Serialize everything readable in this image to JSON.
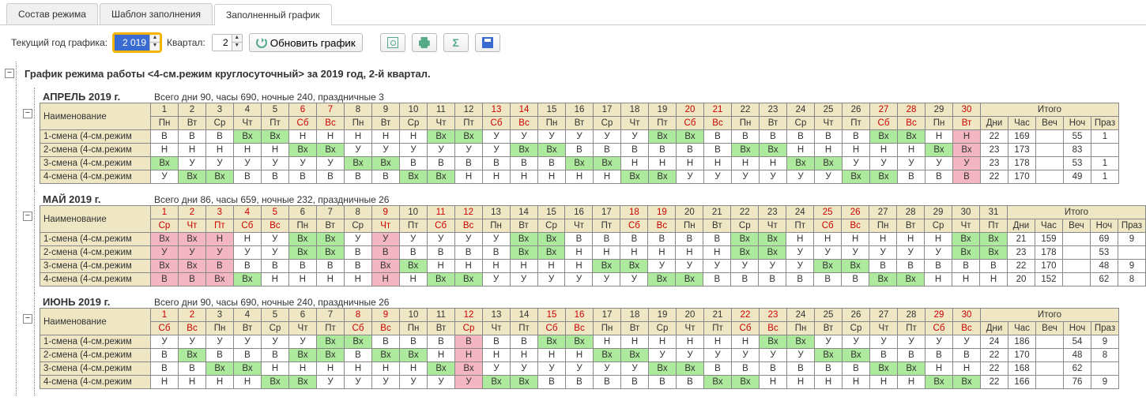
{
  "tabs": [
    "Состав режима",
    "Шаблон заполнения",
    "Заполненный график"
  ],
  "activeTab": 2,
  "toolbar": {
    "yearLabel": "Текущий год графика:",
    "yearValue": "2 019",
    "quarterLabel": "Квартал:",
    "quarterValue": "2",
    "refreshLabel": "Обновить график"
  },
  "title": "График режима работы <4-см.режим круглосуточный> за 2019 год, 2-й квартал.",
  "labels": {
    "name": "Наименование",
    "total": "Итого"
  },
  "sumCols": [
    "Дни",
    "Час",
    "Веч",
    "Ноч",
    "Праз"
  ],
  "dows": [
    "Пн",
    "Вт",
    "Ср",
    "Чт",
    "Пт",
    "Сб",
    "Вс"
  ],
  "rowNames": [
    "1-смена (4-см.режим",
    "2-смена (4-см.режим",
    "3-смена (4-см.режим",
    "4-смена (4-см.режим"
  ],
  "months": [
    {
      "name": "АПРЕЛЬ 2019 г.",
      "summary": "Всего дни 90, часы 690, ночные 240, праздничные 3",
      "days": 30,
      "startDow": 0,
      "holidays": [
        30
      ],
      "rows": [
        {
          "c": [
            "В",
            "В",
            "В",
            "Вх",
            "Вх",
            "Н",
            "Н",
            "Н",
            "Н",
            "Н",
            "Вх",
            "Вх",
            "У",
            "У",
            "У",
            "У",
            "У",
            "У",
            "Вх",
            "Вх",
            "В",
            "В",
            "В",
            "В",
            "В",
            "В",
            "Вх",
            "Вх",
            "Н",
            "Н"
          ],
          "s": [
            "22",
            "169",
            "",
            "55",
            "1"
          ]
        },
        {
          "c": [
            "Н",
            "Н",
            "Н",
            "Н",
            "Н",
            "Вх",
            "Вх",
            "У",
            "У",
            "У",
            "У",
            "У",
            "У",
            "Вх",
            "Вх",
            "В",
            "В",
            "В",
            "В",
            "В",
            "В",
            "Вх",
            "Вх",
            "Н",
            "Н",
            "Н",
            "Н",
            "Н",
            "Вх",
            "Вх"
          ],
          "s": [
            "23",
            "173",
            "",
            "83",
            ""
          ]
        },
        {
          "c": [
            "Вх",
            "У",
            "У",
            "У",
            "У",
            "У",
            "У",
            "Вх",
            "Вх",
            "В",
            "В",
            "В",
            "В",
            "В",
            "В",
            "Вх",
            "Вх",
            "Н",
            "Н",
            "Н",
            "Н",
            "Н",
            "Н",
            "Вх",
            "Вх",
            "У",
            "У",
            "У",
            "У",
            "У"
          ],
          "s": [
            "23",
            "178",
            "",
            "53",
            "1"
          ]
        },
        {
          "c": [
            "У",
            "Вх",
            "Вх",
            "В",
            "В",
            "В",
            "В",
            "В",
            "В",
            "Вх",
            "Вх",
            "Н",
            "Н",
            "Н",
            "Н",
            "Н",
            "Н",
            "Вх",
            "Вх",
            "У",
            "У",
            "У",
            "У",
            "У",
            "У",
            "Вх",
            "Вх",
            "В",
            "В",
            "В"
          ],
          "s": [
            "22",
            "170",
            "",
            "49",
            "1"
          ]
        }
      ]
    },
    {
      "name": "МАЙ 2019 г.",
      "summary": "Всего дни 86, часы 659, ночные 232, праздничные 26",
      "days": 31,
      "startDow": 2,
      "holidays": [
        1,
        2,
        3,
        9
      ],
      "rows": [
        {
          "c": [
            "Вх",
            "Вх",
            "Н",
            "Н",
            "У",
            "Вх",
            "Вх",
            "У",
            "У",
            "У",
            "У",
            "У",
            "У",
            "Вх",
            "Вх",
            "В",
            "В",
            "В",
            "В",
            "В",
            "В",
            "Вх",
            "Вх",
            "Н",
            "Н",
            "Н",
            "Н",
            "Н",
            "Н",
            "Вх",
            "Вх"
          ],
          "s": [
            "21",
            "159",
            "",
            "69",
            "9"
          ]
        },
        {
          "c": [
            "У",
            "У",
            "У",
            "У",
            "У",
            "Вх",
            "Вх",
            "В",
            "В",
            "В",
            "В",
            "В",
            "В",
            "Вх",
            "Вх",
            "Н",
            "Н",
            "Н",
            "Н",
            "Н",
            "Н",
            "Вх",
            "Вх",
            "У",
            "У",
            "У",
            "У",
            "У",
            "У",
            "Вх",
            "Вх"
          ],
          "s": [
            "23",
            "178",
            "",
            "53",
            ""
          ]
        },
        {
          "c": [
            "Вх",
            "Вх",
            "В",
            "В",
            "В",
            "В",
            "В",
            "В",
            "Вх",
            "Вх",
            "Н",
            "Н",
            "Н",
            "Н",
            "Н",
            "Н",
            "Вх",
            "Вх",
            "У",
            "У",
            "У",
            "У",
            "У",
            "У",
            "Вх",
            "Вх",
            "В",
            "В",
            "В",
            "В",
            "В"
          ],
          "s": [
            "22",
            "170",
            "",
            "48",
            "9"
          ]
        },
        {
          "c": [
            "В",
            "В",
            "Вх",
            "Вх",
            "Н",
            "Н",
            "Н",
            "Н",
            "Н",
            "Н",
            "Вх",
            "Вх",
            "У",
            "У",
            "У",
            "У",
            "У",
            "У",
            "Вх",
            "Вх",
            "В",
            "В",
            "В",
            "В",
            "В",
            "В",
            "Вх",
            "Вх",
            "Н",
            "Н",
            "Н"
          ],
          "s": [
            "20",
            "152",
            "",
            "62",
            "8"
          ]
        }
      ]
    },
    {
      "name": "ИЮНЬ 2019 г.",
      "summary": "Всего дни 90, часы 690, ночные 240, праздничные 26",
      "days": 30,
      "startDow": 5,
      "holidays": [
        12
      ],
      "rows": [
        {
          "c": [
            "У",
            "У",
            "У",
            "У",
            "У",
            "У",
            "Вх",
            "Вх",
            "В",
            "В",
            "В",
            "В",
            "В",
            "В",
            "Вх",
            "Вх",
            "Н",
            "Н",
            "Н",
            "Н",
            "Н",
            "Н",
            "Вх",
            "Вх",
            "У",
            "У",
            "У",
            "У",
            "У",
            "У"
          ],
          "s": [
            "24",
            "186",
            "",
            "54",
            "9"
          ]
        },
        {
          "c": [
            "В",
            "Вх",
            "В",
            "В",
            "В",
            "Вх",
            "Вх",
            "В",
            "Вх",
            "Вх",
            "Н",
            "Н",
            "Н",
            "Н",
            "Н",
            "Н",
            "Вх",
            "Вх",
            "У",
            "У",
            "У",
            "У",
            "У",
            "У",
            "Вх",
            "Вх",
            "В",
            "В",
            "В",
            "В"
          ],
          "s": [
            "22",
            "170",
            "",
            "48",
            "8"
          ]
        },
        {
          "c": [
            "В",
            "В",
            "Вх",
            "Вх",
            "Н",
            "Н",
            "Н",
            "Н",
            "Н",
            "Н",
            "Вх",
            "Вх",
            "У",
            "У",
            "У",
            "У",
            "У",
            "У",
            "Вх",
            "Вх",
            "В",
            "В",
            "В",
            "В",
            "В",
            "В",
            "Вх",
            "Вх",
            "Н",
            "Н"
          ],
          "s": [
            "22",
            "168",
            "",
            "62",
            ""
          ]
        },
        {
          "c": [
            "Н",
            "Н",
            "Н",
            "Н",
            "Вх",
            "Вх",
            "У",
            "У",
            "У",
            "У",
            "У",
            "У",
            "Вх",
            "Вх",
            "В",
            "В",
            "В",
            "В",
            "В",
            "В",
            "Вх",
            "Вх",
            "Н",
            "Н",
            "Н",
            "Н",
            "Н",
            "Н",
            "Вх",
            "Вх"
          ],
          "s": [
            "22",
            "166",
            "",
            "76",
            "9"
          ]
        }
      ]
    }
  ]
}
